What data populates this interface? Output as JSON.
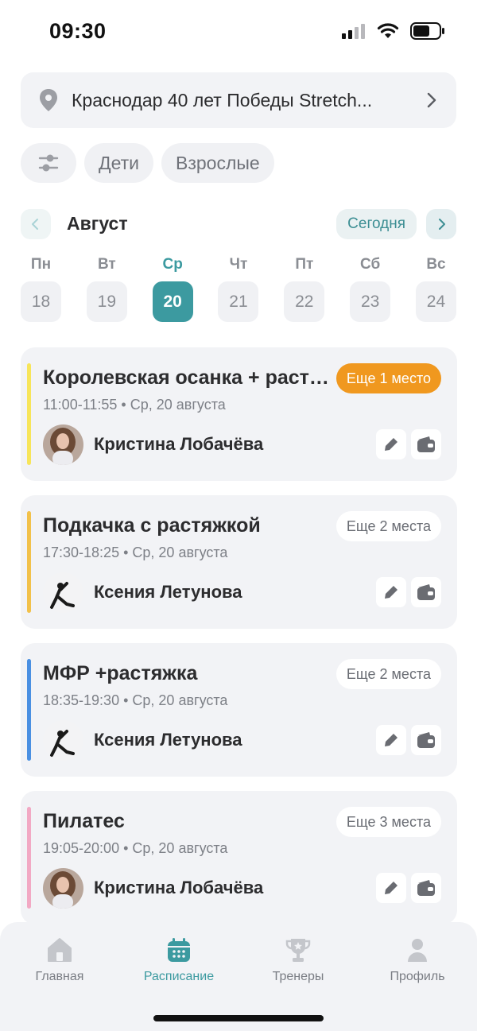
{
  "status_bar": {
    "time": "09:30"
  },
  "location": {
    "text": "Краснодар 40 лет Победы Stretch...",
    "icon": "map-pin-icon"
  },
  "filters": {
    "settings_icon": "sliders-icon",
    "chips": [
      "Дети",
      "Взрослые"
    ]
  },
  "calendar": {
    "month": "Август",
    "today_label": "Сегодня",
    "days": [
      {
        "name": "Пн",
        "num": "18"
      },
      {
        "name": "Вт",
        "num": "19"
      },
      {
        "name": "Ср",
        "num": "20",
        "active": true
      },
      {
        "name": "Чт",
        "num": "21"
      },
      {
        "name": "Пт",
        "num": "22"
      },
      {
        "name": "Сб",
        "num": "23"
      },
      {
        "name": "Вс",
        "num": "24"
      }
    ]
  },
  "classes": [
    {
      "title": "Королевская осанка + растяжка",
      "time": "11:00-11:55",
      "date": "Ср, 20 августа",
      "trainer": "Кристина Лобачёва",
      "badge": "Еще 1 место",
      "badge_style": "orange",
      "stripe_color": "#f7e55a",
      "avatar": "trainer-photo-kristina"
    },
    {
      "title": "Подкачка с растяжкой",
      "time": "17:30-18:25",
      "date": "Ср, 20 августа",
      "trainer": "Ксения Летунова",
      "badge": "Еще 2 места",
      "badge_style": "white",
      "stripe_color": "#f2c14a",
      "avatar": "trainer-photo-ksenia"
    },
    {
      "title": "МФР +растяжка",
      "time": "18:35-19:30",
      "date": "Ср, 20 августа",
      "trainer": "Ксения Летунова",
      "badge": "Еще 2 места",
      "badge_style": "white",
      "stripe_color": "#4a90e2",
      "avatar": "trainer-photo-ksenia"
    },
    {
      "title": "Пилатес",
      "time": "19:05-20:00",
      "date": "Ср, 20 августа",
      "trainer": "Кристина Лобачёва",
      "badge": "Еще 3 места",
      "badge_style": "white",
      "stripe_color": "#f2a9c4",
      "avatar": "trainer-photo-kristina"
    }
  ],
  "tabbar": {
    "tabs": [
      {
        "label": "Главная",
        "icon": "home-icon"
      },
      {
        "label": "Расписание",
        "icon": "calendar-icon",
        "active": true
      },
      {
        "label": "Тренеры",
        "icon": "trophy-icon"
      },
      {
        "label": "Профиль",
        "icon": "user-icon"
      }
    ]
  },
  "colors": {
    "accent": "#3c9aa0",
    "orange": "#f0981f",
    "card_bg": "#f2f3f6"
  }
}
